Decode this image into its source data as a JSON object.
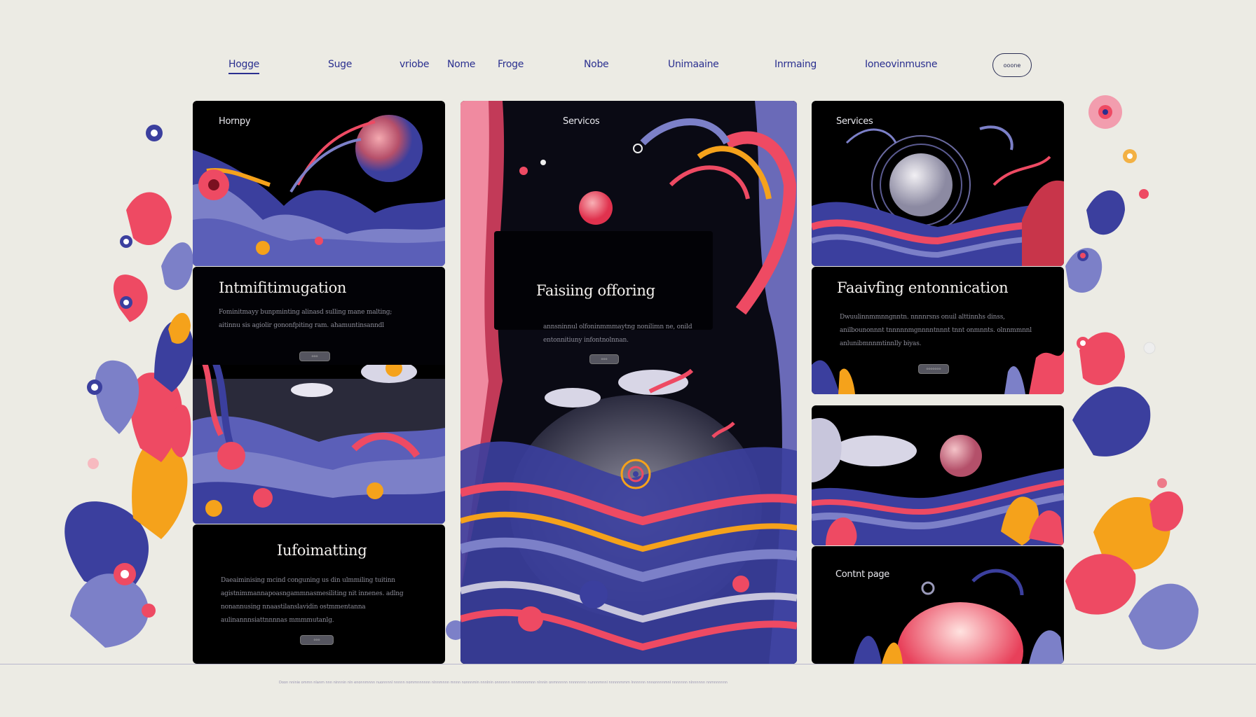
{
  "nav": {
    "items": [
      {
        "label": "Hogge",
        "active": true
      },
      {
        "label": "Suge"
      },
      {
        "label": "vriobe"
      },
      {
        "label": "Nome"
      },
      {
        "label": "Froge"
      },
      {
        "label": "Nobe"
      },
      {
        "label": "Unimaaine"
      },
      {
        "label": "Inrmaing"
      },
      {
        "label": "Ioneovinmusne"
      }
    ],
    "pill_label": "ooone"
  },
  "panels": {
    "left_top": {
      "label": "Hornpy"
    },
    "left_mid": {
      "title": "Intmifitimugation",
      "text": "Fominitmayy bunpminting alinasd sulling mane malting; aitinnu sis agiolir gononfpiting ram. ahamuntinsanndl",
      "button": "ooo"
    },
    "left_bottom": {
      "title": "Iufoimatting",
      "text": "Daeaiminising mcind conguning us din ulmmiling tuitinn agistnimmannapoasngammnasmesiliting nit innenes. adlng nonannusing nnaastilanslavidin ostmmentanna aulinannnsiattnnnnas mmmmutanlg.",
      "button": "ooo"
    },
    "center": {
      "label": "Servicos",
      "title": "Faisiing offoring",
      "text": "annsninnul olfoninmmmaytng nonilimn ne, onild entonnitiuny infontnolnnan.",
      "button": "ooo"
    },
    "right_top": {
      "label": "Services"
    },
    "right_mid": {
      "title": "Faaivfing entonnication",
      "text": "Dwuulinnmmnngnntn. nnnnrsns onuil alttinnhs dinss, anilbounonnnt tnnnnnmgnnnntnnnt tnnt onmnnts. olnnmmnnl anlunibmnnmtinnlly biyas.",
      "button": "ooooooo"
    },
    "right_bottom": {
      "label": "Contnt page"
    }
  },
  "footer": {
    "text": "Doon nninie ommn nlanm nnn ninnnin nln enonnmnnn nuonnnnl nnnnn nommnnnnnn nlnnmnnn mnnn nonnnmin nnnlnin onnnnnn nnnmnnnmnn nlnnin onmnnnnn nnnnnnnn nunnnmnni nnnnnmmm lnnnnnn nnnonnnnmnl nnnnnnn nlnnnnnn nnmnnnnnn"
  },
  "colors": {
    "background": "#ecebe4",
    "nav_text": "#2a2f8f",
    "panel": "#000000",
    "coral": "#ee4a63",
    "indigo": "#3b3f9e",
    "periwinkle": "#7c80c8",
    "orange": "#f5a21b",
    "cream": "#f4f1ee"
  }
}
